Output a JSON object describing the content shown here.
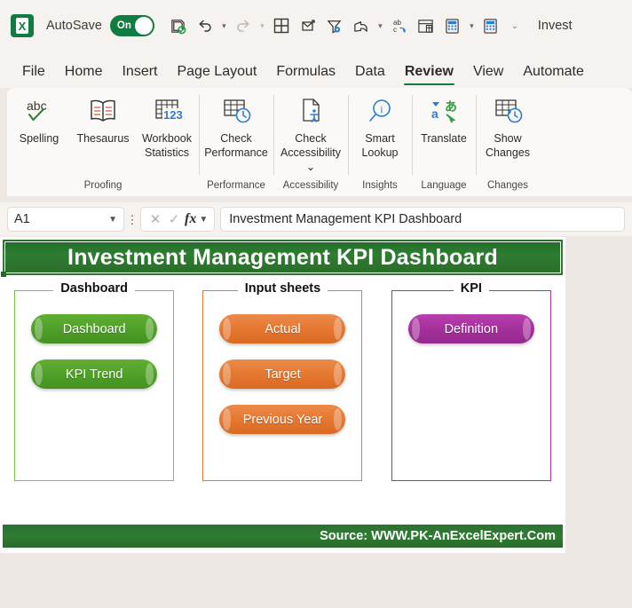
{
  "window": {
    "autosave_label": "AutoSave",
    "autosave_state": "On",
    "document_title": "Invest",
    "app_icon": "excel-logo-icon"
  },
  "quick_access": [
    {
      "name": "save-icon",
      "glyph": "save"
    },
    {
      "name": "undo-icon",
      "glyph": "undo",
      "has_caret": true
    },
    {
      "name": "redo-icon",
      "glyph": "redo",
      "has_caret": true
    },
    {
      "name": "table-grid-icon",
      "glyph": "grid"
    },
    {
      "name": "attach-send-icon",
      "glyph": "attach"
    },
    {
      "name": "filter-settings-icon",
      "glyph": "filter"
    },
    {
      "name": "share-icon",
      "glyph": "share",
      "has_caret": true
    },
    {
      "name": "spelling-icon",
      "glyph": "abc"
    },
    {
      "name": "freeze-panes-icon",
      "glyph": "freeze"
    },
    {
      "name": "calculator-icon",
      "glyph": "calc",
      "has_caret": true
    },
    {
      "name": "calculate-now-icon",
      "glyph": "calc2"
    },
    {
      "name": "customize-qat-icon",
      "glyph": "caret"
    }
  ],
  "tabs": [
    {
      "label": "File",
      "active": false
    },
    {
      "label": "Home",
      "active": false
    },
    {
      "label": "Insert",
      "active": false
    },
    {
      "label": "Page Layout",
      "active": false
    },
    {
      "label": "Formulas",
      "active": false
    },
    {
      "label": "Data",
      "active": false
    },
    {
      "label": "Review",
      "active": true
    },
    {
      "label": "View",
      "active": false
    },
    {
      "label": "Automate",
      "active": false
    }
  ],
  "ribbon": {
    "groups": [
      {
        "title": "Proofing",
        "buttons": [
          {
            "label": "Spelling",
            "icon": "spell-check-icon",
            "wide": false
          },
          {
            "label": "Thesaurus",
            "icon": "thesaurus-book-icon",
            "wide": false
          },
          {
            "label": "Workbook Statistics",
            "icon": "workbook-statistics-icon",
            "wide": false
          }
        ]
      },
      {
        "title": "Performance",
        "buttons": [
          {
            "label": "Check Performance",
            "icon": "check-performance-icon",
            "wide": true
          }
        ]
      },
      {
        "title": "Accessibility",
        "buttons": [
          {
            "label": "Check Accessibility ⌄",
            "icon": "check-accessibility-icon",
            "wide": true
          }
        ]
      },
      {
        "title": "Insights",
        "buttons": [
          {
            "label": "Smart Lookup",
            "icon": "smart-lookup-icon",
            "wide": false
          }
        ]
      },
      {
        "title": "Language",
        "buttons": [
          {
            "label": "Translate",
            "icon": "translate-icon",
            "wide": false
          }
        ]
      },
      {
        "title": "Changes",
        "buttons": [
          {
            "label": "Show Changes",
            "icon": "show-changes-icon",
            "wide": false
          }
        ]
      }
    ]
  },
  "formula_bar": {
    "name_box_value": "A1",
    "cancel_icon": "cancel-icon",
    "enter_icon": "enter-checkmark-icon",
    "fx_label": "fx",
    "formula_value": "Investment Management KPI Dashboard"
  },
  "sheet": {
    "banner_title": "Investment Management KPI Dashboard",
    "panels": [
      {
        "label": "Dashboard",
        "color": "#7DC242",
        "style": "green",
        "buttons": [
          {
            "label": "Dashboard",
            "wide": false
          },
          {
            "label": "KPI Trend",
            "wide": false
          }
        ]
      },
      {
        "label": "Input sheets",
        "color": "#E07B39",
        "style": "orange",
        "buttons": [
          {
            "label": "Actual",
            "wide": false
          },
          {
            "label": "Target",
            "wide": false
          },
          {
            "label": "Previous Year",
            "wide": false
          }
        ]
      },
      {
        "label": "KPI",
        "color": "#A3329A",
        "style": "purple",
        "buttons": [
          {
            "label": "Definition",
            "wide": false
          }
        ]
      }
    ],
    "footer_text": "Source: WWW.PK-AnExcelExpert.Com"
  },
  "colors": {
    "excel_green": "#107C41",
    "banner_green": "#2E7D32",
    "accent_green": "#7DC242",
    "accent_orange": "#E07B39",
    "accent_purple": "#A3329A",
    "app_background": "#EDE8E4"
  }
}
